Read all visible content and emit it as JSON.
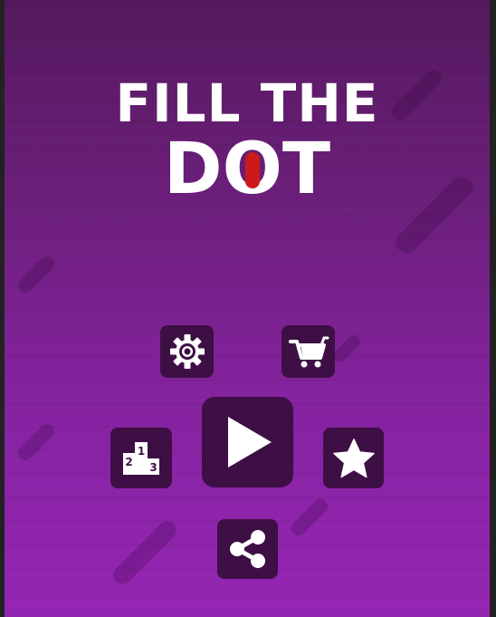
{
  "title": {
    "line1": "FILL THE",
    "line2_before": "D",
    "line2_o": "O",
    "line2_after": "T"
  },
  "colors": {
    "background_top": "#55195e",
    "background_bottom": "#9526b4",
    "button": "#3e0f45",
    "dot": "#cc1a1a"
  },
  "menu": {
    "buttons": [
      {
        "name": "settings-button",
        "icon": "gear-icon"
      },
      {
        "name": "shop-button",
        "icon": "cart-icon"
      },
      {
        "name": "leaderboard-button",
        "icon": "podium-icon",
        "podium_labels": [
          "1",
          "2",
          "3"
        ]
      },
      {
        "name": "play-button",
        "icon": "play-icon"
      },
      {
        "name": "rate-button",
        "icon": "star-icon"
      },
      {
        "name": "share-button",
        "icon": "share-icon"
      }
    ]
  }
}
